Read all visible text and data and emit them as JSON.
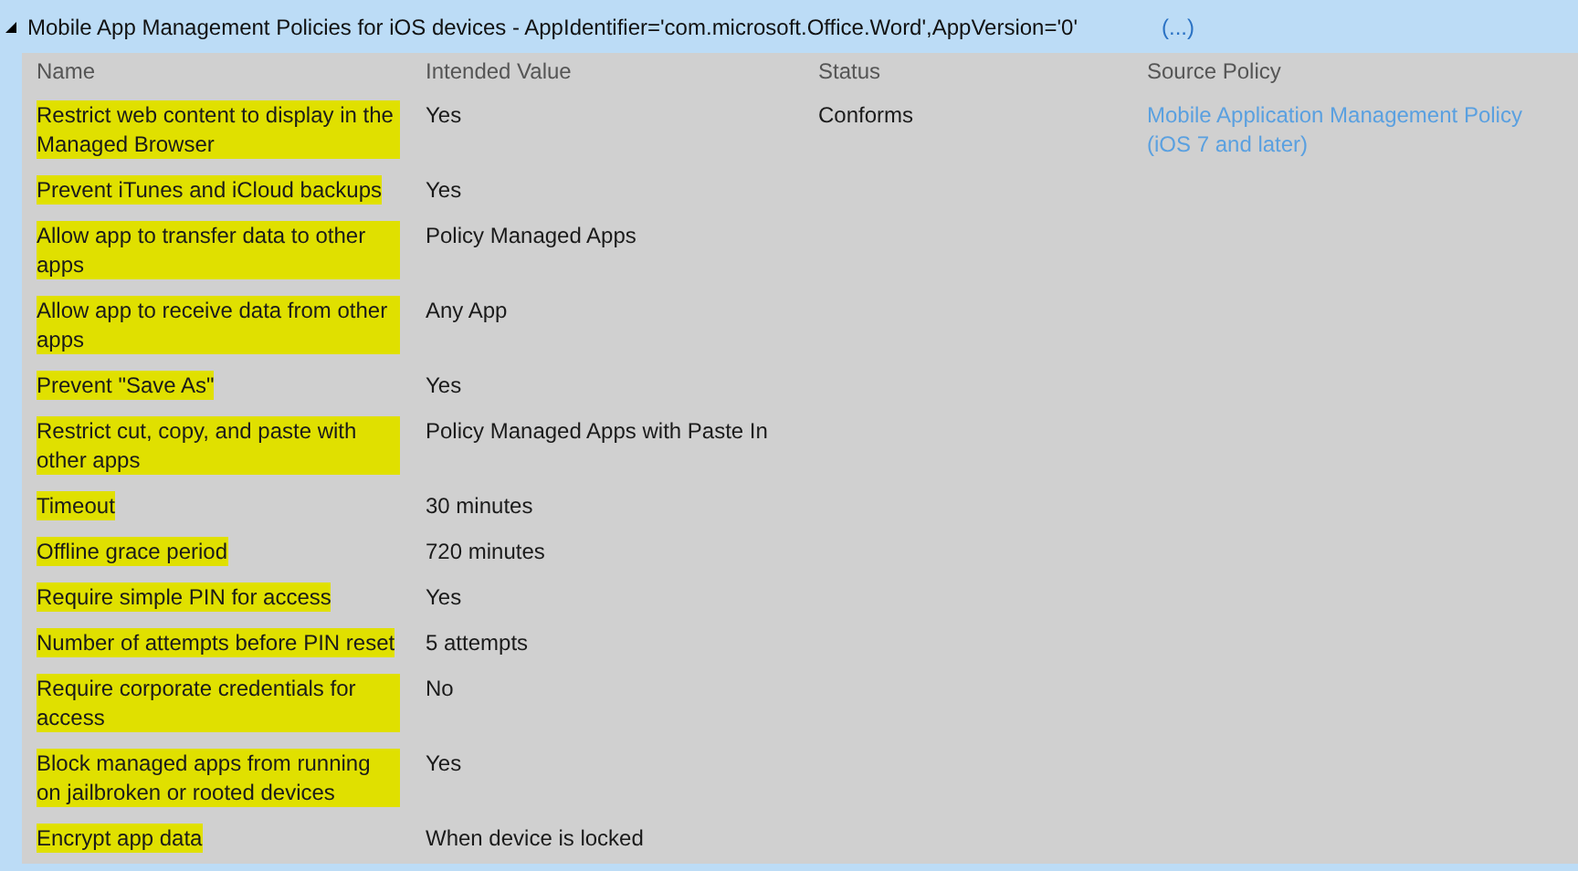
{
  "section": {
    "title": "Mobile App Management Policies for iOS devices - AppIdentifier='com.microsoft.Office.Word',AppVersion='0'",
    "more": "(...)",
    "expanded": true
  },
  "table": {
    "columns": [
      "Name",
      "Intended Value",
      "Status",
      "Source Policy"
    ],
    "rows": [
      {
        "name": "Restrict web content to display in the Managed Browser",
        "value": "Yes",
        "status": "Conforms",
        "source": "Mobile Application Management Policy (iOS 7 and later)",
        "highlighted": true
      },
      {
        "name": "Prevent iTunes and iCloud backups",
        "value": "Yes",
        "highlighted": true
      },
      {
        "name": "Allow app to transfer data to other apps",
        "value": "Policy Managed Apps",
        "highlighted": true
      },
      {
        "name": "Allow app to receive data from other apps",
        "value": "Any App",
        "highlighted": true
      },
      {
        "name": "Prevent \"Save As\"",
        "value": "Yes",
        "highlighted": true
      },
      {
        "name": "Restrict cut, copy, and paste with other apps",
        "value": "Policy Managed Apps with Paste In",
        "highlighted": true
      },
      {
        "name": "Timeout",
        "value": "30 minutes",
        "highlighted": true
      },
      {
        "name": "Offline grace period",
        "value": "720 minutes",
        "highlighted": true
      },
      {
        "name": "Require simple PIN for access",
        "value": "Yes",
        "highlighted": true
      },
      {
        "name": "Number of attempts before PIN reset",
        "value": "5 attempts",
        "highlighted": true
      },
      {
        "name": "Require corporate credentials for access",
        "value": "No",
        "highlighted": true
      },
      {
        "name": "Block managed apps from running on jailbroken or rooted devices",
        "value": "Yes",
        "highlighted": true
      },
      {
        "name": "Encrypt app data",
        "value": "When device is locked",
        "highlighted": true
      }
    ]
  }
}
